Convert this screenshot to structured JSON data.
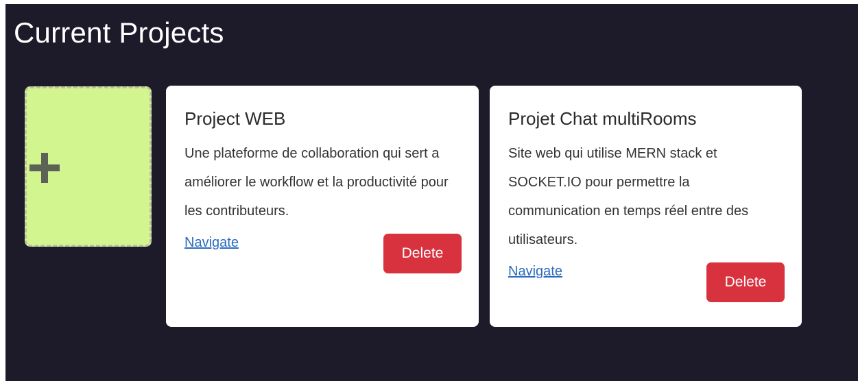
{
  "header": {
    "title": "Current Projects"
  },
  "add_project": {
    "icon": "plus-icon",
    "background_color": "#d3f58f"
  },
  "projects": [
    {
      "title": "Project WEB",
      "description": "Une plateforme de collaboration qui sert a améliorer le workflow et la productivité pour les contributeurs.",
      "navigate_label": "Navigate",
      "delete_label": "Delete"
    },
    {
      "title": "Projet Chat multiRooms",
      "description": "Site web qui utilise MERN stack et SOCKET.IO pour permettre la communication en temps réel entre des utilisateurs.",
      "navigate_label": "Navigate",
      "delete_label": "Delete"
    }
  ],
  "colors": {
    "page_background": "#1d1a2a",
    "card_background": "#ffffff",
    "delete_button": "#d9323f",
    "link": "#2d6bbf"
  }
}
